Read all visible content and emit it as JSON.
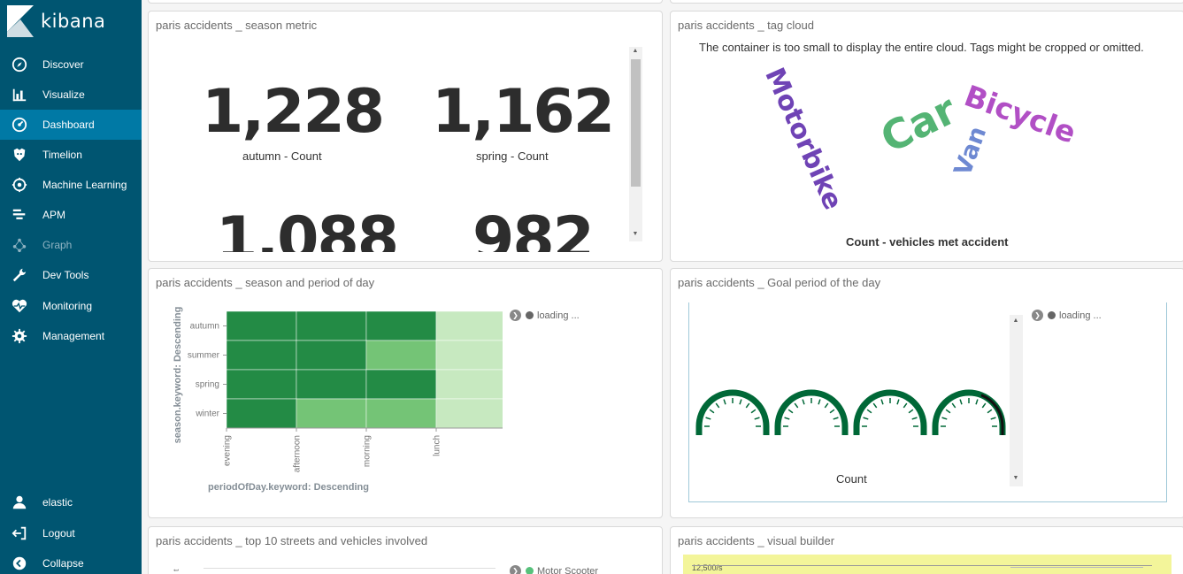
{
  "app": {
    "name": "kibana"
  },
  "sidebar": {
    "items": [
      {
        "label": "Discover",
        "icon": "compass-icon"
      },
      {
        "label": "Visualize",
        "icon": "bar-chart-icon"
      },
      {
        "label": "Dashboard",
        "icon": "dashboard-icon",
        "active": true
      },
      {
        "label": "Timelion",
        "icon": "timelion-icon"
      },
      {
        "label": "Machine Learning",
        "icon": "machine-learning-icon"
      },
      {
        "label": "APM",
        "icon": "apm-icon"
      },
      {
        "label": "Graph",
        "icon": "graph-icon",
        "disabled": true
      },
      {
        "label": "Dev Tools",
        "icon": "wrench-icon"
      },
      {
        "label": "Monitoring",
        "icon": "heartbeat-icon"
      },
      {
        "label": "Management",
        "icon": "gear-icon"
      }
    ],
    "bottom": [
      {
        "label": "elastic",
        "icon": "user-icon"
      },
      {
        "label": "Logout",
        "icon": "logout-icon"
      },
      {
        "label": "Collapse",
        "icon": "collapse-icon"
      }
    ]
  },
  "panels": {
    "season_metric": {
      "title": "paris accidents _ season metric",
      "metrics": [
        {
          "value": "1,228",
          "label": "autumn - Count"
        },
        {
          "value": "1,162",
          "label": "spring - Count"
        },
        {
          "value": "1,088",
          "label": ""
        },
        {
          "value": "982",
          "label": ""
        }
      ]
    },
    "tag_cloud": {
      "title": "paris accidents _ tag cloud",
      "warning": "The container is too small to display the entire cloud. Tags might be cropped or omitted.",
      "words": [
        {
          "text": "Motorbike",
          "color": "#6f43b5"
        },
        {
          "text": "Car",
          "color": "#54b474"
        },
        {
          "text": "Van",
          "color": "#6e89d2"
        },
        {
          "text": "Bicycle",
          "color": "#b14fc5"
        }
      ],
      "label": "Count - vehicles met accident"
    },
    "heatmap": {
      "title": "paris accidents _ season and period of day",
      "legend_loading": "loading ...",
      "chart_data": {
        "type": "heatmap",
        "x_categories": [
          "evening",
          "afternoon",
          "morning",
          "lunch"
        ],
        "y_categories": [
          "autumn",
          "summer",
          "spring",
          "winter"
        ],
        "levels": [
          [
            3,
            3,
            3,
            1
          ],
          [
            3,
            3,
            2,
            1
          ],
          [
            3,
            3,
            3,
            1
          ],
          [
            3,
            2,
            2,
            1
          ]
        ],
        "colors": {
          "1": "#c7e9c0",
          "2": "#74c476",
          "3": "#238b45"
        },
        "xlabel": "periodOfDay.keyword: Descending",
        "ylabel": "season.keyword: Descending"
      }
    },
    "goal": {
      "title": "paris accidents _ Goal period of the day",
      "legend_loading": "loading ...",
      "label": "Count",
      "gauge_count": 4,
      "gauge_color": "#006837"
    },
    "streets": {
      "title": "paris accidents _ top 10 streets and vehicles involved",
      "legend_item": "Motor Scooter",
      "legend_color": "#57c17b"
    },
    "visual_builder": {
      "title": "paris accidents _ visual builder",
      "tick_label": "12,500/s",
      "bg_color": "#f3f59a"
    }
  }
}
